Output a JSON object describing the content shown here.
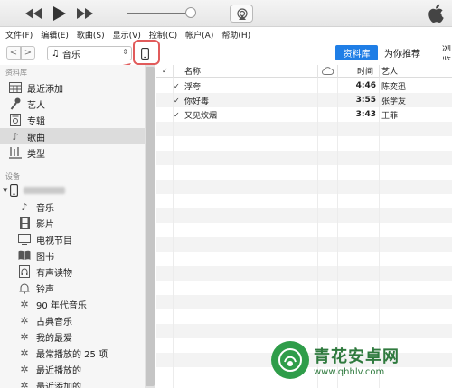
{
  "player": {
    "prev_icon": "rewind-icon",
    "play_icon": "play-icon",
    "next_icon": "fast-forward-icon",
    "volume_level": 0.9,
    "airplay_icon": "airplay-icon",
    "logo_icon": "apple-logo-icon"
  },
  "menu": [
    "文件(F)",
    "编辑(E)",
    "歌曲(S)",
    "显示(V)",
    "控制(C)",
    "帐户(A)",
    "帮助(H)"
  ],
  "nav": {
    "back": "<",
    "forward": ">",
    "media_label": "音乐",
    "media_icon": "music-note-icon"
  },
  "tabs": {
    "library": "资料库",
    "for_you": "为你推荐",
    "browse": "浏览"
  },
  "sidebar": {
    "library_title": "资料库",
    "library_items": [
      {
        "label": "最近添加",
        "icon": "recently-added-icon"
      },
      {
        "label": "艺人",
        "icon": "microphone-icon"
      },
      {
        "label": "专辑",
        "icon": "album-icon"
      },
      {
        "label": "歌曲",
        "icon": "music-note-icon"
      },
      {
        "label": "类型",
        "icon": "genre-icon"
      }
    ],
    "devices_title": "设备",
    "device_items": [
      {
        "label": "音乐",
        "icon": "music-note-icon"
      },
      {
        "label": "影片",
        "icon": "film-icon"
      },
      {
        "label": "电视节目",
        "icon": "tv-icon"
      },
      {
        "label": "图书",
        "icon": "book-icon"
      },
      {
        "label": "有声读物",
        "icon": "audiobook-icon"
      },
      {
        "label": "铃声",
        "icon": "bell-icon"
      },
      {
        "label": "90 年代音乐",
        "icon": "gear-icon"
      },
      {
        "label": "古典音乐",
        "icon": "gear-icon"
      },
      {
        "label": "我的最爱",
        "icon": "gear-icon"
      },
      {
        "label": "最常播放的 25 项",
        "icon": "gear-icon"
      },
      {
        "label": "最近播放的",
        "icon": "gear-icon"
      },
      {
        "label": "最近添加的",
        "icon": "gear-icon"
      }
    ]
  },
  "list": {
    "header": {
      "check": "✓",
      "name": "名称",
      "time": "时间",
      "artist": "艺人",
      "cloud_icon": "cloud-icon"
    },
    "rows": [
      {
        "check": "✓",
        "name": "浮夸",
        "time": "4:46",
        "artist": "陈奕迅"
      },
      {
        "check": "✓",
        "name": "你好毒",
        "time": "3:55",
        "artist": "张学友"
      },
      {
        "check": "✓",
        "name": "又见炊烟",
        "time": "3:43",
        "artist": "王菲"
      }
    ]
  },
  "watermark": {
    "title": "青花安卓网",
    "url": "www.qhhlv.com"
  },
  "colors": {
    "accent": "#1f7ee6",
    "annotation": "#e15b5b",
    "watermark": "#2f7a3e"
  }
}
